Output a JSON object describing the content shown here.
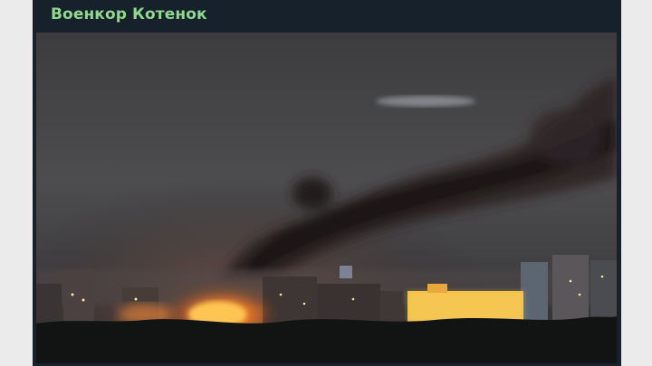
{
  "post": {
    "channel_name": "Военкор Котенок"
  },
  "media": {
    "type": "photo",
    "scene": "night-city-fire-smoke"
  },
  "colors": {
    "background": "#17212b",
    "channel_name": "#8fd88c",
    "fire": "#ff8a2a",
    "smoke": "#2a2222",
    "sky": "#4a4a4c"
  }
}
